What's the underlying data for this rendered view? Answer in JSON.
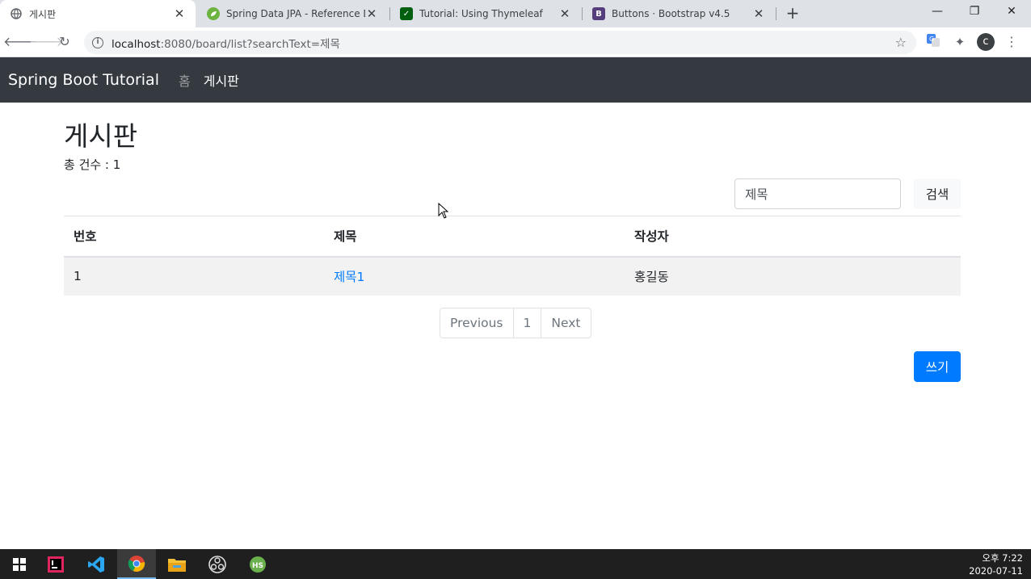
{
  "browser": {
    "tabs": [
      {
        "title": "게시판",
        "active": true,
        "favicon": "globe-icon"
      },
      {
        "title": "Spring Data JPA - Reference Do",
        "active": false,
        "favicon": "spring-leaf-icon"
      },
      {
        "title": "Tutorial: Using Thymeleaf",
        "active": false,
        "favicon": "thymeleaf-icon"
      },
      {
        "title": "Buttons · Bootstrap v4.5",
        "active": false,
        "favicon": "bootstrap-icon"
      }
    ],
    "url_host": "localhost",
    "url_rest": ":8080/board/list?searchText=제목",
    "profile_initial": "c"
  },
  "navbar": {
    "brand": "Spring Boot Tutorial",
    "links": [
      {
        "label": "홈",
        "active": false
      },
      {
        "label": "게시판",
        "active": true
      }
    ]
  },
  "page": {
    "title": "게시판",
    "count_text": "총 건수 : 1",
    "search": {
      "value": "제목",
      "button": "검색"
    },
    "table": {
      "headers": [
        "번호",
        "제목",
        "작성자"
      ],
      "rows": [
        {
          "no": "1",
          "title": "제목1",
          "author": "홍길동"
        }
      ]
    },
    "pagination": [
      "Previous",
      "1",
      "Next"
    ],
    "write_button": "쓰기"
  },
  "taskbar": {
    "time": "오후 7:22",
    "date": "2020-07-11"
  },
  "colors": {
    "navbar_bg": "#343a40",
    "primary": "#007bff",
    "link": "#007bff"
  }
}
